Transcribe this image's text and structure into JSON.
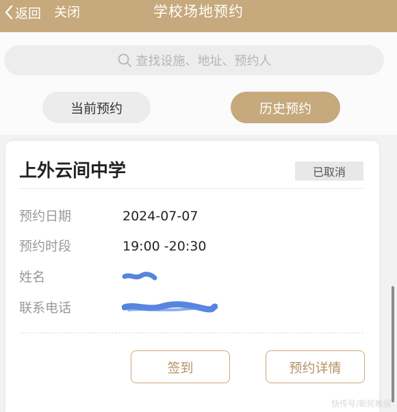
{
  "header": {
    "back_label": "返回",
    "close_label": "关闭",
    "title": "学校场地预约"
  },
  "search": {
    "placeholder": "查找设施、地址、预约人"
  },
  "tabs": {
    "current": "当前预约",
    "history": "历史预约",
    "active": "history"
  },
  "booking": {
    "school": "上外云间中学",
    "status": "已取消",
    "fields": [
      {
        "label": "预约日期",
        "value": "2024-07-07"
      },
      {
        "label": "预约时段",
        "value": "19:00 -20:30"
      },
      {
        "label": "姓名",
        "value": ""
      },
      {
        "label": "联系电话",
        "value": ""
      }
    ],
    "actions": {
      "checkin": "签到",
      "detail": "预约详情"
    }
  },
  "watermark": "快传号/新民晚报",
  "colors": {
    "accent": "#c6a97c",
    "redaction": "#3a6fd8"
  }
}
